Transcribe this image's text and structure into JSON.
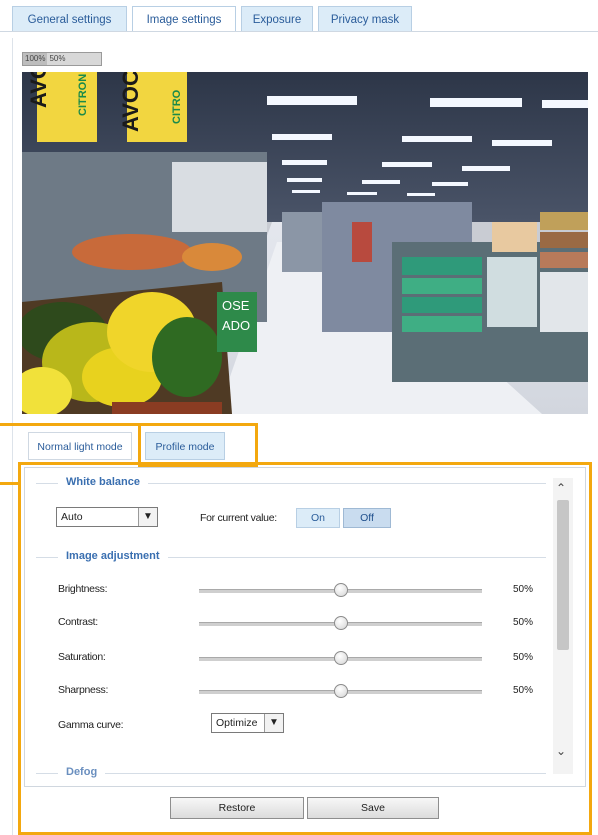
{
  "tabs": [
    "General settings",
    "Image settings",
    "Exposure",
    "Privacy mask"
  ],
  "active_tab": "Image settings",
  "zoom_buttons": [
    "100%",
    "50%"
  ],
  "video": {
    "sign_left": "AVOC",
    "sign_left_sub": "CITRON",
    "sign_right": "AVOC",
    "sign_right_sub": "CITRO",
    "green_sign_line1": "OSE",
    "green_sign_line2": "ADO"
  },
  "mode_tabs": [
    "Normal light mode",
    "Profile mode"
  ],
  "active_mode_tab": "Profile mode",
  "white_balance": {
    "title": "White balance",
    "mode": "Auto",
    "for_current_value_label": "For current value:",
    "on_label": "On",
    "off_label": "Off"
  },
  "image_adjustment": {
    "title": "Image adjustment",
    "sliders": [
      {
        "label": "Brightness:",
        "value": "50%",
        "level": 0.5
      },
      {
        "label": "Contrast:",
        "value": "50%",
        "level": 0.5
      },
      {
        "label": "Saturation:",
        "value": "50%",
        "level": 0.5
      },
      {
        "label": "Sharpness:",
        "value": "50%",
        "level": 0.5
      }
    ],
    "gamma_label": "Gamma curve:",
    "gamma_value": "Optimize"
  },
  "next_section": "Defog",
  "buttons": {
    "restore": "Restore",
    "save": "Save"
  },
  "colors": {
    "highlight": "#f3a80f",
    "tab_text": "#2a5c9a",
    "section_title": "#3a6fb0"
  }
}
